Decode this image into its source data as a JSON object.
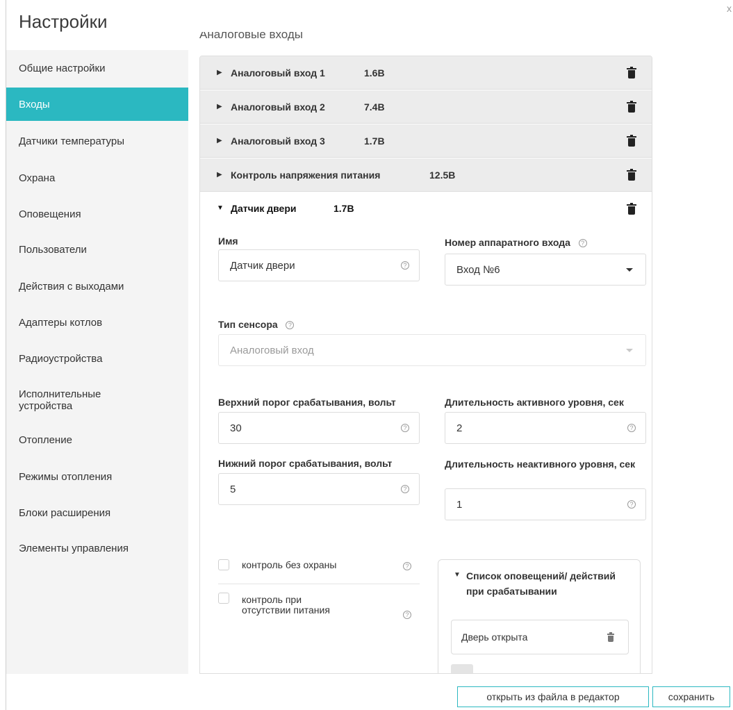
{
  "window": {
    "title": "Настройки",
    "close": "x"
  },
  "sidebar": {
    "items": [
      {
        "label": "Общие настройки"
      },
      {
        "label": "Входы"
      },
      {
        "label": "Датчики температуры"
      },
      {
        "label": "Охрана"
      },
      {
        "label": "Оповещения"
      },
      {
        "label": "Пользователи"
      },
      {
        "label": "Действия с выходами"
      },
      {
        "label": "Адаптеры котлов"
      },
      {
        "label": "Радиоустройства"
      },
      {
        "label": "Исполнительные устройства"
      },
      {
        "label": "Отопление"
      },
      {
        "label": "Режимы отопления"
      },
      {
        "label": "Блоки расширения"
      },
      {
        "label": "Элементы управления"
      }
    ],
    "active": "Входы",
    "active_color": "#2bb8c1"
  },
  "section_header": "Аналоговые входы",
  "inputs": [
    {
      "name": "Аналоговый вход 1",
      "value": "1.6В"
    },
    {
      "name": "Аналоговый вход 2",
      "value": "7.4В"
    },
    {
      "name": "Аналоговый вход 3",
      "value": "1.7В"
    },
    {
      "name": "Контроль напряжения питания",
      "value": "12.5В"
    }
  ],
  "expanded": {
    "name": "Датчик двери",
    "value": "1.7В",
    "name_label": "Имя",
    "name_value": "Датчик двери",
    "hw_input_label": "Номер аппаратного входа",
    "hw_input_value": "Вход №6",
    "sensor_type_label": "Тип сенсора",
    "sensor_type_value": "Аналоговый вход",
    "upper_label": "Верхний порог срабатывания, вольт",
    "upper_value": "30",
    "active_dur_label": "Длительность активного уровня, сек",
    "active_dur_value": "2",
    "lower_label": "Нижний порог срабатывания, вольт",
    "lower_value": "5",
    "inactive_dur_label": "Длительность неактивного уровня, сек",
    "inactive_dur_value": "1",
    "checkbox1": "контроль без охраны",
    "checkbox2": "контроль при отсутствии питания",
    "notif_title": "Список оповещений/ действий при срабатывании",
    "notif_item": "Дверь открыта"
  },
  "footer": {
    "open_file": "открыть из файла в редактор",
    "save": "сохранить"
  },
  "help_glyph": "?"
}
